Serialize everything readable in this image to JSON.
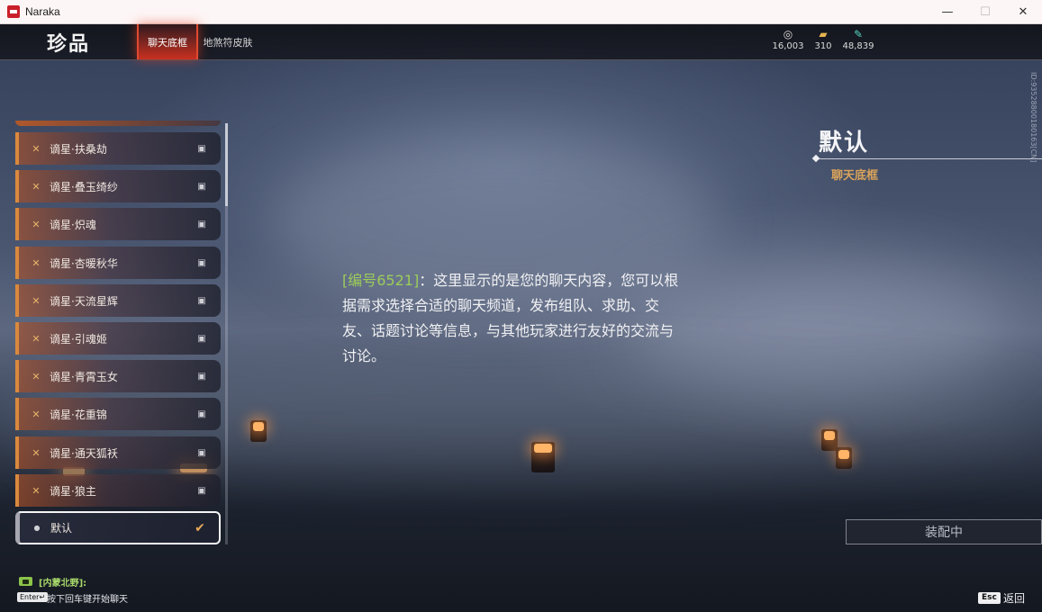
{
  "window": {
    "title": "Naraka",
    "minimize": "—",
    "maximize": "☐",
    "close": "✕"
  },
  "header": {
    "title": "珍品",
    "tabs": [
      {
        "label": "聊天底框",
        "active": true
      },
      {
        "label": "地煞符皮肤",
        "active": false
      }
    ],
    "currencies": [
      {
        "icon": "coin-stack-icon",
        "value": "16,003"
      },
      {
        "icon": "gold-ingot-icon",
        "value": "310"
      },
      {
        "icon": "feather-icon",
        "value": "48,839"
      }
    ]
  },
  "list": {
    "items": [
      {
        "label": "谪星·扶桑劫",
        "locked": true
      },
      {
        "label": "谪星·叠玉绮纱",
        "locked": true
      },
      {
        "label": "谪星·炽魂",
        "locked": true
      },
      {
        "label": "谪星·杏暖秋华",
        "locked": true
      },
      {
        "label": "谪星·天流星辉",
        "locked": true
      },
      {
        "label": "谪星·引魂姬",
        "locked": true
      },
      {
        "label": "谪星·青霄玉女",
        "locked": true
      },
      {
        "label": "谪星·花重锦",
        "locked": true
      },
      {
        "label": "谪星·通天狐袄",
        "locked": true
      },
      {
        "label": "谪星·狼主",
        "locked": true
      }
    ],
    "default_item": {
      "label": "默认",
      "selected": true
    },
    "scroll_position": 0.0
  },
  "detail": {
    "name": "默认",
    "type": "聊天底框",
    "side_id": "ID:93528800180163[CN]"
  },
  "preview": {
    "tag": "[编号6521]",
    "text": "：这里显示的是您的聊天内容，您可以根据需求选择合适的聊天频道，发布组队、求助、交友、话题讨论等信息，与其他玩家进行友好的交流与讨论。"
  },
  "equip_button": {
    "label": "装配中"
  },
  "chat": {
    "channel": "[内蒙北野]:",
    "enter_key": "Enter↵",
    "hint": "按下回车键开始聊天"
  },
  "footer": {
    "esc_key": "Esc",
    "back_label": "返回"
  },
  "colors": {
    "accent_orange": "#d9893e",
    "tab_red": "#e04a30",
    "chat_green": "#9ccc5a",
    "type_gold": "#d9a35a"
  }
}
